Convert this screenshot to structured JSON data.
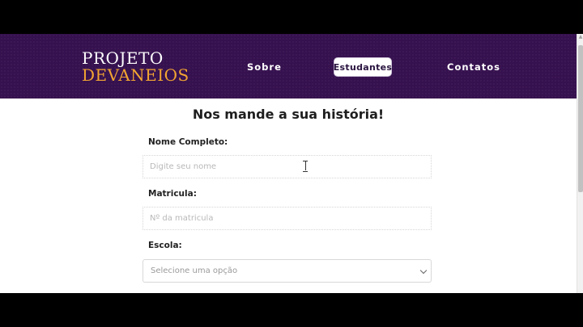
{
  "header": {
    "logo_line1": "PROJETO",
    "logo_line2": "DEVANEIOS",
    "nav": {
      "sobre": "Sobre",
      "estudantes": "Estudantes",
      "contatos": "Contatos"
    },
    "colors": {
      "background": "#36114f",
      "logo_accent": "#f2a531"
    }
  },
  "form": {
    "title": "Nos mande a sua história!",
    "nome": {
      "label": "Nome Completo:",
      "placeholder": "Digite seu nome",
      "value": ""
    },
    "matricula": {
      "label": "Matricula:",
      "placeholder": "Nº da matricula",
      "value": ""
    },
    "escola": {
      "label": "Escola:",
      "selected": "Selecione uma opção"
    }
  },
  "icons": {
    "select_arrow": "chevron-down-icon",
    "scroll_up": "arrow-up-icon",
    "mouse_cursor": "text-cursor-icon"
  }
}
